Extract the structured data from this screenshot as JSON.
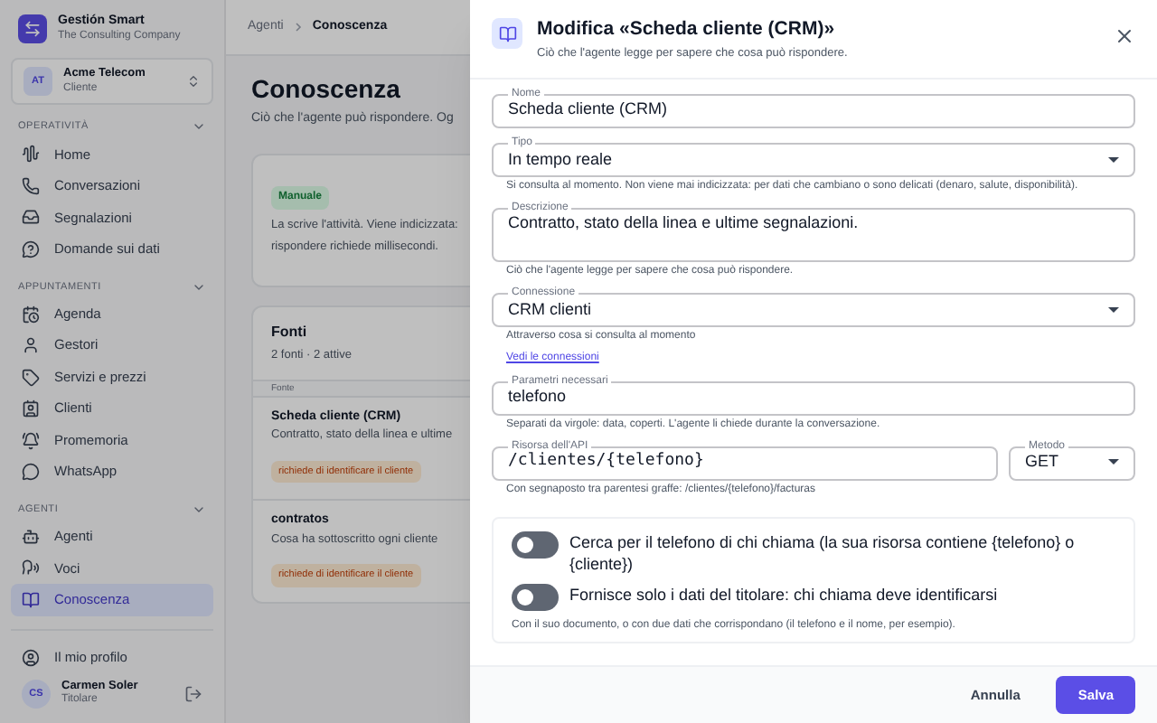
{
  "sidebar": {
    "brand": {
      "name": "Gestión Smart",
      "subtitle": "The Consulting Company"
    },
    "account": {
      "initials": "AT",
      "name": "Acme Telecom",
      "role": "Cliente"
    },
    "sections": [
      {
        "title": "OPERATIVITÀ",
        "expanded": true,
        "items": [
          {
            "label": "Home",
            "selected": false
          },
          {
            "label": "Conversazioni",
            "selected": false
          },
          {
            "label": "Segnalazioni",
            "selected": false
          },
          {
            "label": "Domande sui dati",
            "selected": false
          }
        ]
      },
      {
        "title": "APPUNTAMENTI",
        "expanded": true,
        "items": [
          {
            "label": "Agenda",
            "selected": false
          },
          {
            "label": "Gestori",
            "selected": false
          },
          {
            "label": "Servizi e prezzi",
            "selected": false
          },
          {
            "label": "Clienti",
            "selected": false
          },
          {
            "label": "Promemoria",
            "selected": false
          },
          {
            "label": "WhatsApp",
            "selected": false
          }
        ]
      },
      {
        "title": "AGENTI",
        "expanded": true,
        "items": [
          {
            "label": "Agenti",
            "selected": false
          },
          {
            "label": "Voci",
            "selected": false
          },
          {
            "label": "Conoscenza",
            "selected": true
          }
        ]
      }
    ],
    "profile_link": "Il mio profilo",
    "user": {
      "initials": "CS",
      "name": "Carmen Soler",
      "role": "Titolare"
    }
  },
  "main": {
    "breadcrumb": [
      {
        "label": "Agenti",
        "selected": false
      },
      {
        "label": "Conoscenza",
        "selected": true
      }
    ],
    "title": "Conoscenza",
    "subtitle": "Ciò che l'agente può rispondere. Og",
    "manual_card": {
      "badge": "Manuale",
      "lines": [
        "La scrive l'attività. Viene indicizzata:",
        "rispondere richiede millisecondi."
      ]
    },
    "sources": {
      "title": "Fonti",
      "count": "2 fonti · 2 attive",
      "column_1": "Fonte",
      "rows": [
        {
          "name": "Scheda cliente (CRM)",
          "description": "Contratto, stato della linea e ultime",
          "tag": "richiede di identificare il cliente"
        },
        {
          "name": "contratos",
          "description": "Cosa ha sottoscritto ogni cliente",
          "tag": "richiede di identificare il cliente"
        }
      ]
    }
  },
  "drawer": {
    "title": "Modifica «Scheda cliente (CRM)»",
    "subtitle": "Ciò che l'agente legge per sapere che cosa può rispondere.",
    "fields": [
      {
        "kind": "text",
        "label": "Nome",
        "value": "Scheda cliente (CRM)"
      },
      {
        "kind": "select",
        "label": "Tipo",
        "value": "In tempo reale",
        "helper": "Si consulta al momento. Non viene mai indicizzata: per dati che cambiano o sono delicati (denaro, salute, disponibilità)."
      },
      {
        "kind": "textarea",
        "label": "Descrizione",
        "value": "Contratto, stato della linea e ultime segnalazioni.",
        "helper": "Ciò che l'agente legge per sapere che cosa può rispondere."
      },
      {
        "kind": "select",
        "label": "Connessione",
        "value": "CRM clienti",
        "helper": "Attraverso cosa si consulta al momento",
        "link": "Vedi le connessioni"
      },
      {
        "kind": "text",
        "label": "Parametri necessari",
        "value": "telefono",
        "helper": "Separati da virgole: data, coperti. L'agente li chiede durante la conversazione."
      },
      {
        "kind": "pair",
        "fields": [
          {
            "kind": "code",
            "label": "Risorsa dell'API",
            "value": "/clientes/{telefono}"
          },
          {
            "kind": "select",
            "label": "Metodo",
            "value": "GET"
          }
        ],
        "helper": "Con segnaposto tra parentesi graffe: /clientes/{telefono}/facturas"
      }
    ],
    "toggles": [
      {
        "label": "Cerca per il telefono di chi chiama (la sua risorsa contiene {telefono} o {cliente})",
        "on": false
      },
      {
        "label": "Fornisce solo i dati del titolare: chi chiama deve identificarsi",
        "on": false
      }
    ],
    "toggle_note": "Con il suo documento, o con due dati che corrispondano (il telefono e il nome, per esempio).",
    "buttons": {
      "cancel": "Annulla",
      "save": "Salva"
    }
  }
}
